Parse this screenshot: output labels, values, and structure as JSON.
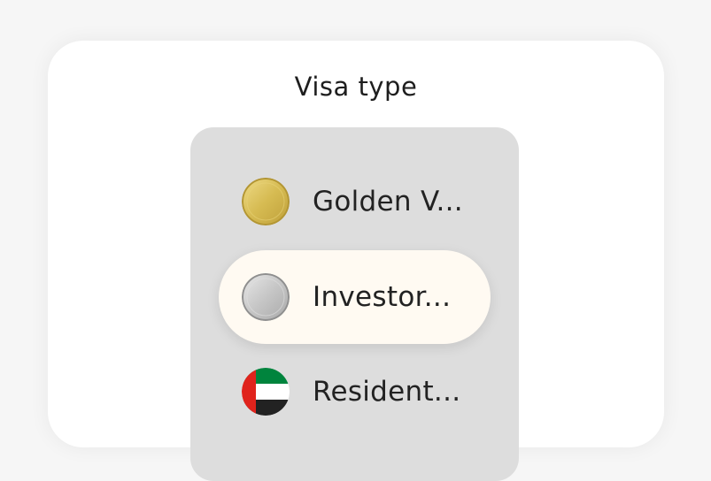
{
  "panel": {
    "title": "Visa type"
  },
  "options": [
    {
      "label": "Golden V...",
      "icon": "gold-coin-icon",
      "selected": false
    },
    {
      "label": "Investor...",
      "icon": "silver-coin-icon",
      "selected": true
    },
    {
      "label": "Resident...",
      "icon": "uae-flag-icon",
      "selected": false
    }
  ],
  "colors": {
    "card_bg": "#ffffff",
    "picker_bg": "#dddddd",
    "selected_bg": "#fffaf2",
    "gold": "#d9bf57",
    "silver": "#c9c9c9",
    "flag_red": "#e0231c",
    "flag_green": "#00843d",
    "flag_black": "#222222"
  }
}
